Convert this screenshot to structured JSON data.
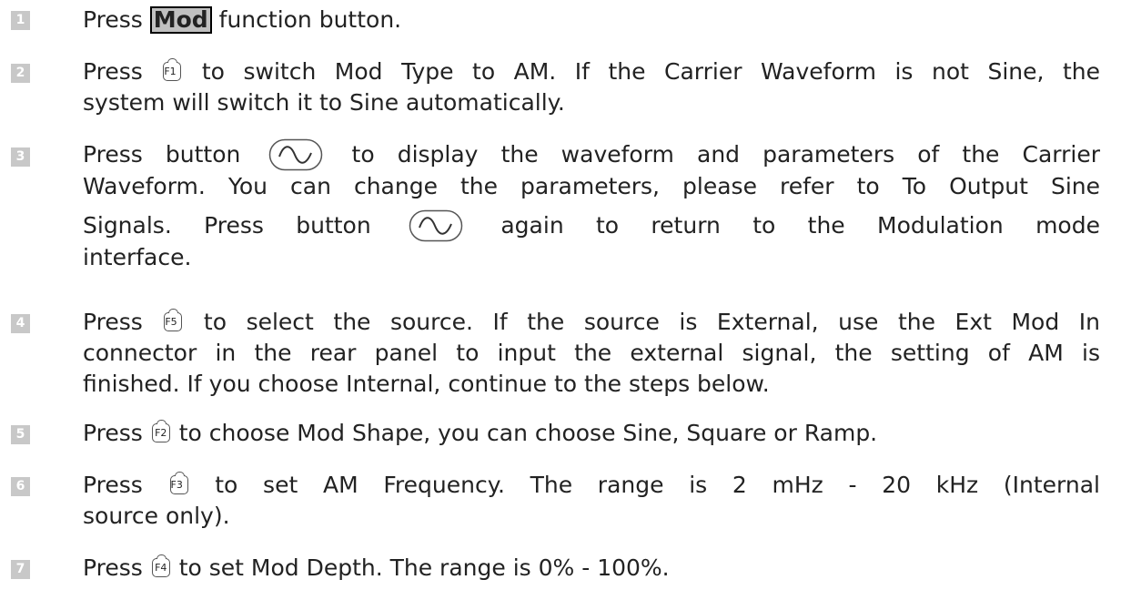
{
  "steps": [
    {
      "num": "1",
      "t1": "Press ",
      "key": "Mod",
      "t2": " function button."
    },
    {
      "num": "2",
      "t1": "Press ",
      "key": "F1",
      "t2": " to switch Mod Type to AM. If the Carrier Waveform is not Sine, the",
      "t3": "system will switch it to Sine automatically."
    },
    {
      "num": "3",
      "t1": "Press button ",
      "t2": " to display the waveform and parameters of the Carrier",
      "t3": "Waveform. You can change the parameters, please refer to To Output Sine",
      "t4": "Signals. Press button ",
      "t5": " again to return to the Modulation mode",
      "t6": "interface."
    },
    {
      "num": "4",
      "t1": "Press ",
      "key": "F5",
      "t2": " to select the source. If the source is External, use the Ext Mod In",
      "t3": "connector in the rear panel to input the external signal, the setting of AM is",
      "t4": "finished. If you choose Internal, continue to the steps below."
    },
    {
      "num": "5",
      "t1": "Press ",
      "key": "F2",
      "t2": " to choose Mod Shape, you can choose Sine, Square or Ramp."
    },
    {
      "num": "6",
      "t1": "Press ",
      "key": "F3",
      "t2": " to set AM Frequency. The range is 2 mHz - 20 kHz (Internal",
      "t3": "source only)."
    },
    {
      "num": "7",
      "t1": "Press ",
      "key": "F4",
      "t2": " to set Mod Depth. The range is 0% - 100%."
    }
  ]
}
